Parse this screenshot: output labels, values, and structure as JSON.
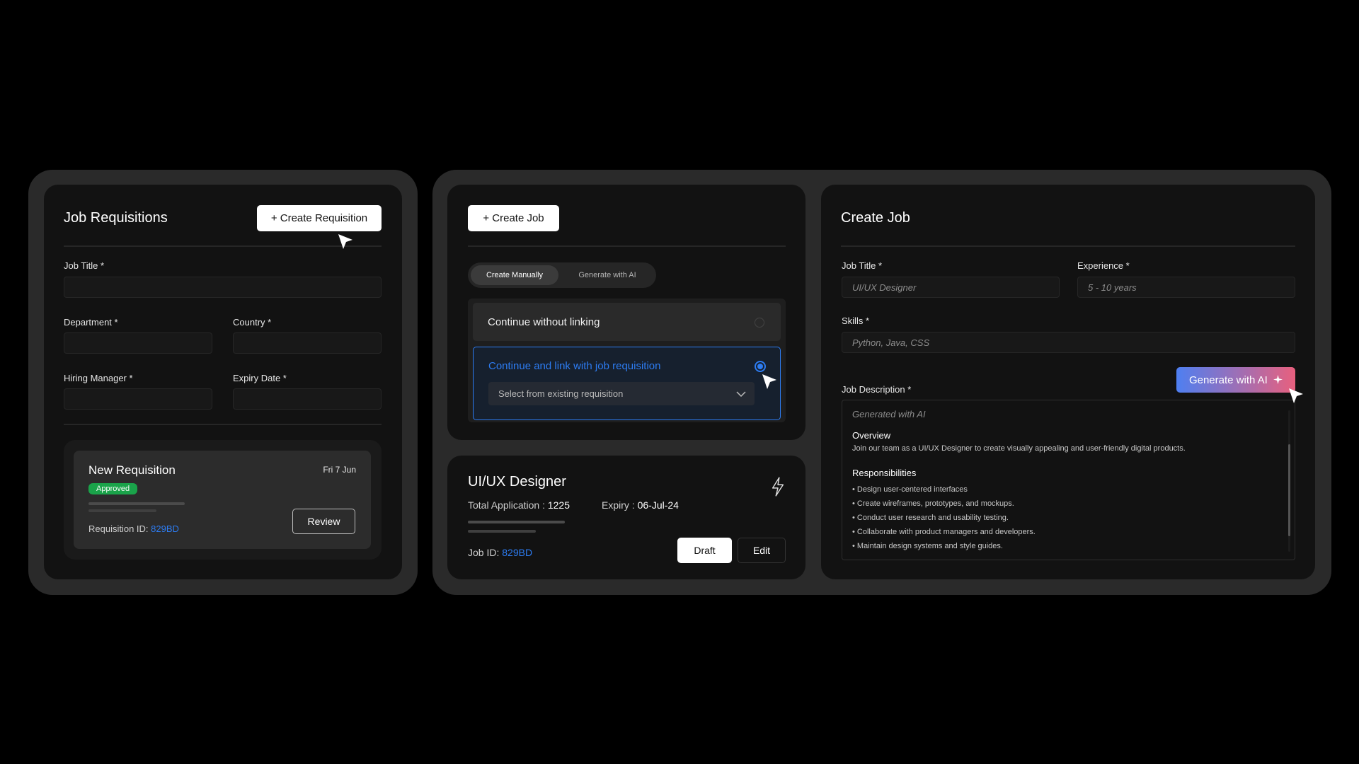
{
  "requisitions": {
    "title": "Job Requisitions",
    "create_button": "+ Create Requisition",
    "fields": {
      "job_title": "Job Title *",
      "department": "Department *",
      "country": "Country *",
      "hiring_manager": "Hiring Manager *",
      "expiry_date": "Expiry Date *"
    },
    "item": {
      "title": "New Requisition",
      "date": "Fri 7 Jun",
      "status": "Approved",
      "id_label": "Requisition ID:",
      "id_value": "829BD",
      "review_button": "Review"
    }
  },
  "create_job_panel": {
    "create_button": "+ Create Job",
    "tabs": [
      "Create Manually",
      "Generate with AI"
    ],
    "active_tab": "Create Manually",
    "option_unlinked": "Continue without linking",
    "option_linked": "Continue and link with job requisition",
    "select_placeholder": "Select from existing requisition"
  },
  "job_card": {
    "title": "UI/UX Designer",
    "applications_label": "Total Application :",
    "applications_value": "1225",
    "expiry_label": "Expiry :",
    "expiry_value": "06-Jul-24",
    "id_label": "Job ID:",
    "id_value": "829BD",
    "draft_button": "Draft",
    "edit_button": "Edit"
  },
  "create_job_form": {
    "title": "Create Job",
    "job_title_label": "Job Title *",
    "job_title_placeholder": "UI/UX Designer",
    "experience_label": "Experience *",
    "experience_placeholder": "5 - 10 years",
    "skills_label": "Skills *",
    "skills_placeholder": "Python, Java, CSS",
    "generate_button": "Generate with AI",
    "description_label": "Job Description *",
    "description_generated": "Generated with AI",
    "overview_heading": "Overview",
    "overview_text": "Join our team as a UI/UX Designer to create visually appealing and user-friendly digital products.",
    "responsibilities_heading": "Responsibilities",
    "responsibilities": [
      "Design user-centered interfaces",
      "Create wireframes, prototypes, and mockups.",
      "Conduct user research and usability testing.",
      "Collaborate with product managers and developers.",
      "Maintain design systems and style guides."
    ]
  },
  "colors": {
    "accent_blue": "#2d7cf2",
    "approved_green": "#1aa34a",
    "gradient_start": "#4e7ff1",
    "gradient_end": "#e8607e"
  }
}
